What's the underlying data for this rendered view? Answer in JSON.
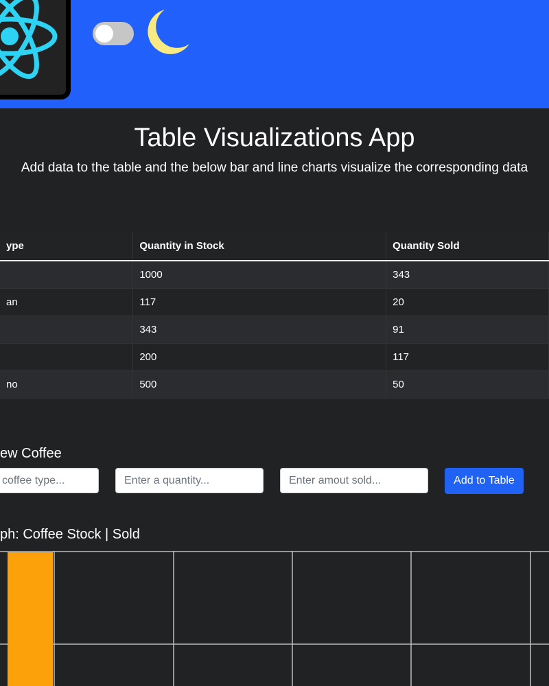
{
  "header": {
    "logo_icon": "react-atom-logo-icon",
    "toggle_icon": "theme-toggle",
    "moon_icon": "moon-icon",
    "accent_color": "#2160fb"
  },
  "page": {
    "title": "Table Visualizations App",
    "subtitle": "Add data to the table and the below bar and line charts visualize the corresponding data"
  },
  "table": {
    "headers": [
      "ype",
      "Quantity in Stock",
      "Quantity Sold"
    ],
    "rows": [
      [
        "",
        "1000",
        "343"
      ],
      [
        "an",
        "117",
        "20"
      ],
      [
        "",
        "343",
        "91"
      ],
      [
        "",
        "200",
        "117"
      ],
      [
        "no",
        "500",
        "50"
      ]
    ]
  },
  "form": {
    "title": "ew Coffee",
    "type_placeholder": "coffee type...",
    "quantity_placeholder": "Enter a quantity...",
    "sold_placeholder": "Enter amout sold...",
    "add_label": "Add to Table"
  },
  "graph": {
    "title": "ph: Coffee Stock | Sold"
  },
  "chart_data": {
    "type": "bar",
    "colors": {
      "bar": "#fca10a",
      "grid": "#bdbdbd"
    },
    "grid": true
  }
}
